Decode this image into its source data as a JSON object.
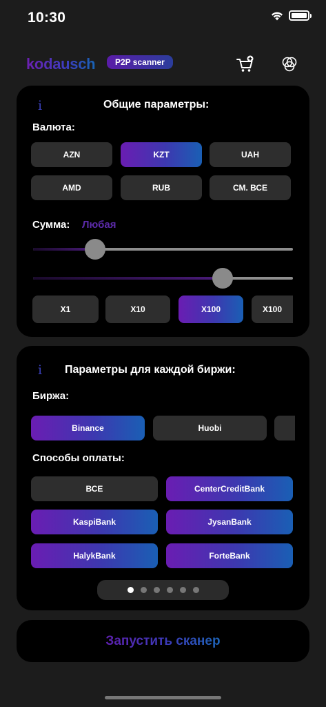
{
  "status_bar": {
    "time": "10:30"
  },
  "header": {
    "logo": "kodausch",
    "badge": "P2P scanner",
    "cart_icon": "cart-plus-icon",
    "layers_icon": "layers-circles-icon"
  },
  "general_params": {
    "info_glyph": "i",
    "title": "Общие параметры:",
    "currency_label": "Валюта:",
    "currencies": [
      "AZN",
      "KZT",
      "UAH",
      "AMD",
      "RUB",
      "СМ. ВСЕ"
    ],
    "selected_currency": "KZT",
    "amount_label": "Сумма:",
    "amount_value": "Любая",
    "slider_1_level": 0.24,
    "slider_2_level": 0.73,
    "multipliers": [
      "X1",
      "X10",
      "X100",
      "X100"
    ],
    "selected_multiplier": "X100"
  },
  "exchange_params": {
    "info_glyph": "i",
    "title": "Параметры для каждой биржи:",
    "exchange_label": "Биржа:",
    "exchanges": [
      "Binance",
      "Huobi",
      ""
    ],
    "selected_exchange": "Binance",
    "payment_label": "Способы оплаты:",
    "payment_methods": [
      "ВСЕ",
      "CenterCreditBank",
      "KaspiBank",
      "JysanBank",
      "HalykBank",
      "ForteBank"
    ],
    "selected_payments": [
      "CenterCreditBank",
      "KaspiBank",
      "JysanBank",
      "HalykBank",
      "ForteBank"
    ],
    "pages_total": 6,
    "page_active": 1
  },
  "start_button": {
    "label": "Запустить сканер"
  },
  "colors": {
    "accent_purple": "#6a1db2",
    "accent_blue": "#1a5fb4",
    "background": "#1c1c1c",
    "card": "#000000",
    "pill": "#2e2e2e"
  }
}
